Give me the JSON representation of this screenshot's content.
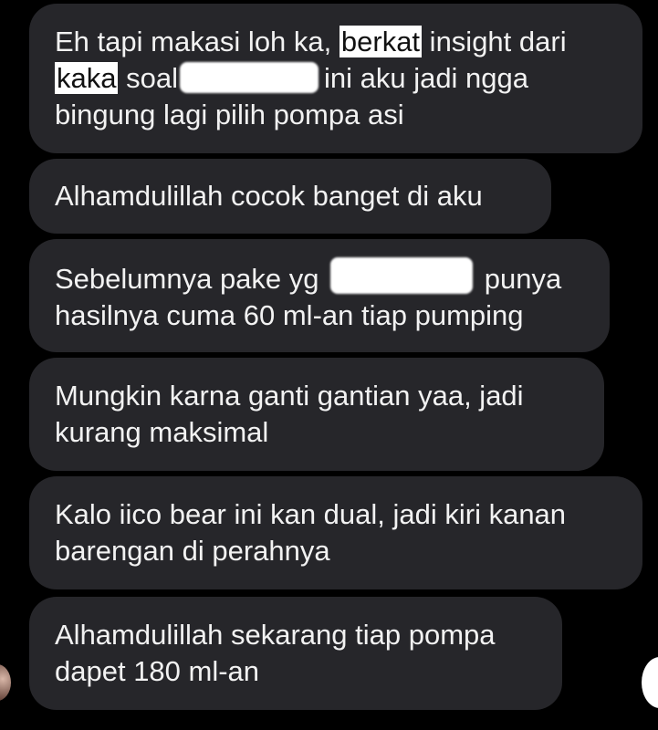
{
  "messages": [
    {
      "line1_a": "Eh tapi makasi loh ka, ",
      "line1_hl": "berkat",
      "line1_b": " insight dari",
      "line2_hl": "kaka",
      "line2_a": " soal",
      "line2_b": "ini aku jadi ngga",
      "line3": "bingung lagi pilih pompa asi"
    },
    {
      "line1": "Alhamdulillah cocok banget di aku"
    },
    {
      "line1_a": "Sebelumnya pake yg ",
      "line1_b": " punya",
      "line2": "hasilnya cuma 60 ml-an tiap pumping"
    },
    {
      "line1": "Mungkin karna ganti gantian yaa, jadi",
      "line2": "kurang maksimal"
    },
    {
      "line1": "Kalo iico bear ini kan dual, jadi kiri kanan",
      "line2": "barengan di perahnya"
    },
    {
      "line1": "Alhamdulillah sekarang tiap pompa",
      "line2": "dapet 180 ml-an"
    }
  ],
  "colors": {
    "background": "#000000",
    "bubble": "#26262a",
    "text": "#f2f2f2",
    "highlight": "#ffffff"
  }
}
